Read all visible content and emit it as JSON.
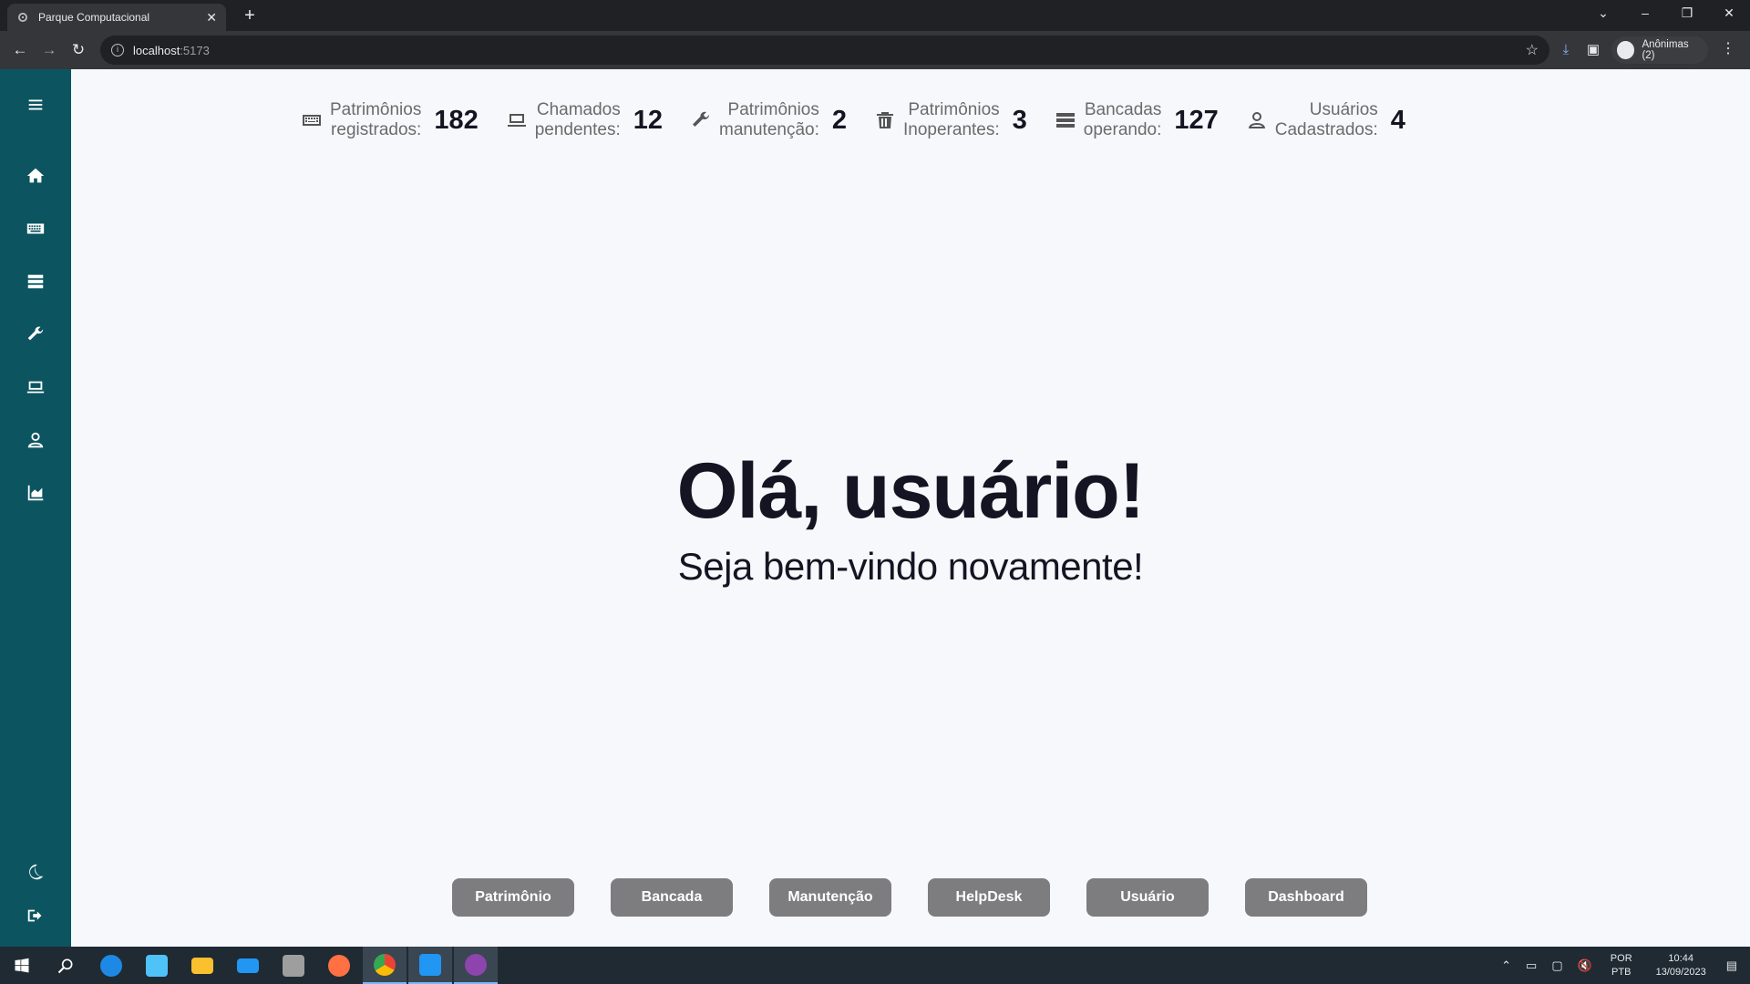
{
  "browser": {
    "tab_title": "Parque Computacional",
    "url_host": "localhost",
    "url_port": ":5173",
    "profile_label": "Anônimas (2)"
  },
  "stats": [
    {
      "label_line1": "Patrimônios",
      "label_line2": "registrados:",
      "value": "182",
      "icon": "keyboard-icon"
    },
    {
      "label_line1": "Chamados",
      "label_line2": "pendentes:",
      "value": "12",
      "icon": "laptop-icon"
    },
    {
      "label_line1": "Patrimônios",
      "label_line2": "manutenção:",
      "value": "2",
      "icon": "wrench-icon"
    },
    {
      "label_line1": "Patrimônios",
      "label_line2": "Inoperantes:",
      "value": "3",
      "icon": "trash-icon"
    },
    {
      "label_line1": "Bancadas",
      "label_line2": "operando:",
      "value": "127",
      "icon": "server-icon"
    },
    {
      "label_line1": "Usuários",
      "label_line2": "Cadastrados:",
      "value": "4",
      "icon": "user-icon"
    }
  ],
  "main": {
    "heading": "Olá, usuário!",
    "subheading": "Seja bem-vindo novamente!"
  },
  "buttons": [
    "Patrimônio",
    "Bancada",
    "Manutenção",
    "HelpDesk",
    "Usuário",
    "Dashboard"
  ],
  "taskbar": {
    "lang_line1": "POR",
    "lang_line2": "PTB",
    "time": "10:44",
    "date": "13/09/2023"
  },
  "colors": {
    "sidebar": "#0c5560",
    "button": "#7d7d7f",
    "background": "#f7f8fc"
  }
}
